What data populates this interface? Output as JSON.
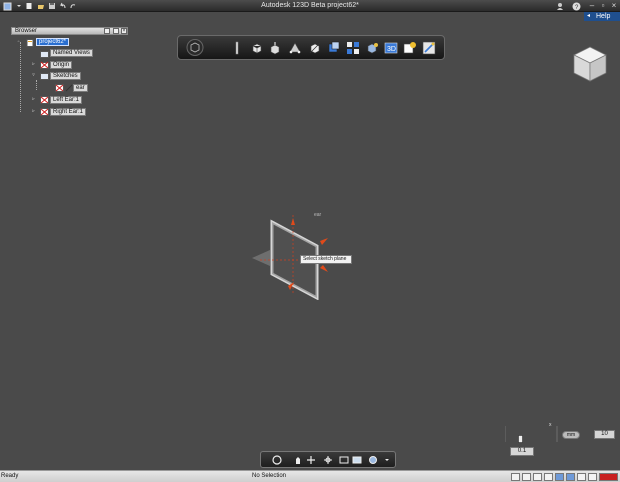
{
  "title_bar": {
    "app_title": "Autodesk 123D Beta   project62*",
    "window_buttons": [
      "minimize-icon",
      "restore-icon",
      "close-icon"
    ]
  },
  "help": {
    "label": "Help"
  },
  "browser": {
    "title": "Browser",
    "items": [
      {
        "label": "project62*",
        "selected": true,
        "icon": "document-icon"
      },
      {
        "label": "Named Views",
        "icon": "folder-icon"
      },
      {
        "label": "Origin",
        "icon": "folder-icon"
      },
      {
        "label": "Sketches",
        "icon": "folder-icon"
      },
      {
        "label": "ear",
        "icon": "sketch-icon"
      },
      {
        "label": "Left Ear:1",
        "icon": "component-icon"
      },
      {
        "label": "Right Ear:1",
        "icon": "component-icon"
      }
    ]
  },
  "toolbar": {
    "buttons": [
      "primitives-icon",
      "sketch-icon",
      "construct-icon",
      "modify-icon",
      "pattern-icon",
      "grouping-icon",
      "combine-icon",
      "measure-icon",
      "text-icon",
      "smart-icon",
      "material-icon"
    ]
  },
  "canvas": {
    "tooltip": "Select sketch plane",
    "sketch_label": "ear"
  },
  "grid_controls": {
    "unit": "mm",
    "grid_size": "10",
    "step": "0.1",
    "x_marker": "x"
  },
  "status": {
    "left": "Ready",
    "middle": "No Selection"
  }
}
